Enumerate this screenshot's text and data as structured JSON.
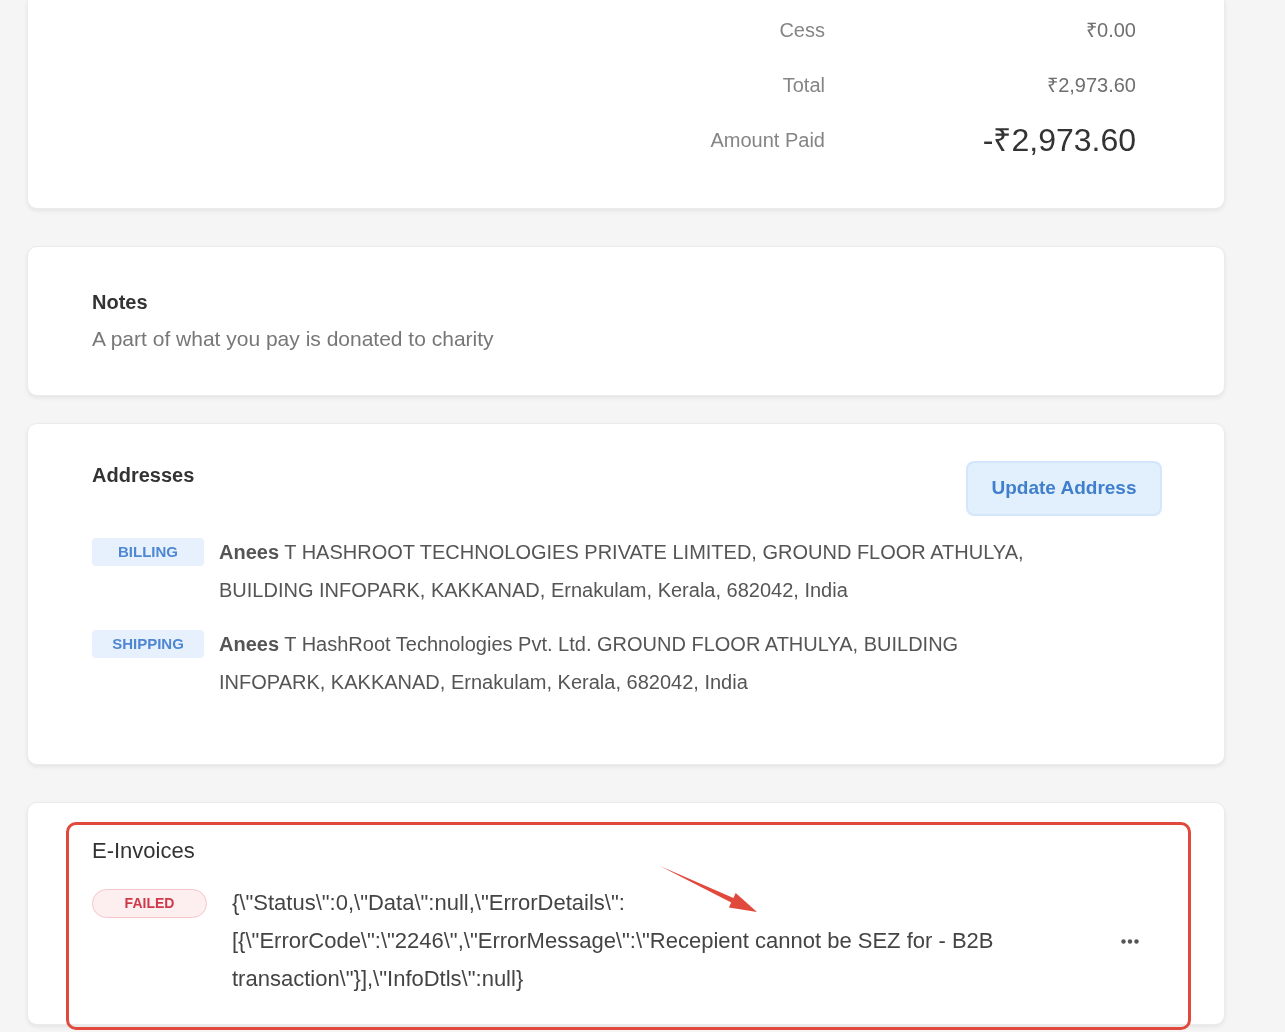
{
  "summary": {
    "rows": [
      {
        "kind": "line",
        "label": "Cess",
        "value": "₹0.00"
      },
      {
        "kind": "line",
        "label": "Total",
        "value": "₹2,973.60"
      },
      {
        "kind": "grand",
        "label": "Amount Paid",
        "value": "-₹2,973.60"
      }
    ]
  },
  "notes": {
    "title": "Notes",
    "text": "A part of what you pay is donated to charity"
  },
  "addresses": {
    "title": "Addresses",
    "button": "Update Address",
    "items": [
      {
        "type": "BILLING",
        "text": "**Anees** T HASHROOT TECHNOLOGIES PRIVATE LIMITED, GROUND FLOOR ATHULYA, BUILDING INFOPARK, KAKKANAD, Ernakulam, Kerala, 682042, India"
      },
      {
        "type": "SHIPPING",
        "text": "**Anees** T HashRoot Technologies Pvt. Ltd. GROUND FLOOR ATHULYA, BUILDING INFOPARK, KAKKANAD, Ernakulam, Kerala, 682042, India"
      }
    ]
  },
  "e_invoices": {
    "title": "E-Invoices",
    "items": [
      {
        "status": "FAILED",
        "message": "{\\\"Status\\\":0,\\\"Data\\\":null,\\\"ErrorDetails\\\":[{\\\"ErrorCode\\\":\\\"2246\\\",\\\"ErrorMessage\\\":\\\"Recepient cannot be SEZ for - B2B transaction\\\"}],\\\"InfoDtls\\\":null}"
      }
    ]
  }
}
